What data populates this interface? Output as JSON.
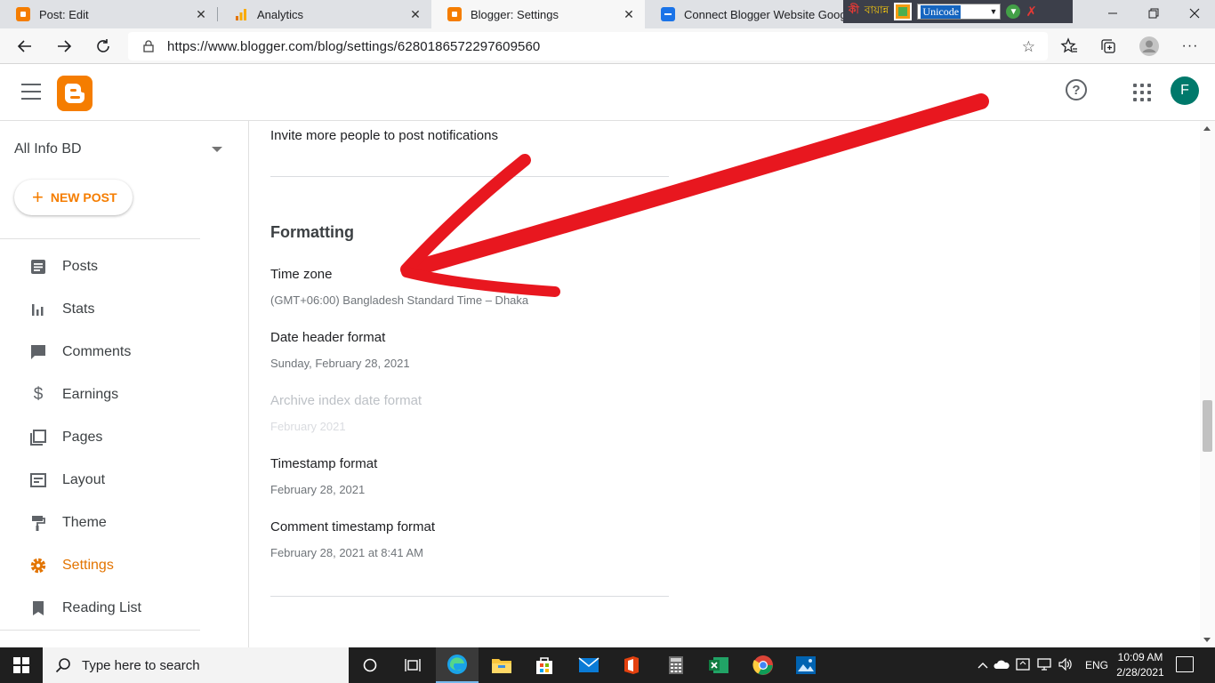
{
  "browser": {
    "tabs": [
      {
        "title": "Post: Edit",
        "icon_color": "#f57d00"
      },
      {
        "title": "Analytics",
        "icon_color": "#f9ab00"
      },
      {
        "title": "Blogger: Settings",
        "icon_color": "#f57d00"
      },
      {
        "title": "Connect Blogger Website Googl",
        "icon_color": "#1a73e8"
      }
    ],
    "language_widget": {
      "brand": "বায়ান্ন",
      "selected": "Unicode"
    },
    "url": "https://www.blogger.com/blog/settings/6280186572297609560"
  },
  "header": {
    "avatar_letter": "F",
    "help_glyph": "?"
  },
  "sidebar": {
    "blog_name": "All Info BD",
    "new_post_label": "NEW POST",
    "items": [
      {
        "label": "Posts",
        "icon": "posts-icon"
      },
      {
        "label": "Stats",
        "icon": "stats-icon"
      },
      {
        "label": "Comments",
        "icon": "comments-icon"
      },
      {
        "label": "Earnings",
        "icon": "dollar-icon"
      },
      {
        "label": "Pages",
        "icon": "pages-icon"
      },
      {
        "label": "Layout",
        "icon": "layout-icon"
      },
      {
        "label": "Theme",
        "icon": "paint-roller-icon"
      },
      {
        "label": "Settings",
        "icon": "gear-icon",
        "active": true
      },
      {
        "label": "Reading List",
        "icon": "bookmark-icon"
      }
    ]
  },
  "main": {
    "invite_text": "Invite more people to post notifications",
    "section_title": "Formatting",
    "settings": [
      {
        "label": "Time zone",
        "value": "(GMT+06:00) Bangladesh Standard Time – Dhaka",
        "disabled": false
      },
      {
        "label": "Date header format",
        "value": "Sunday, February 28, 2021",
        "disabled": false
      },
      {
        "label": "Archive index date format",
        "value": "February 2021",
        "disabled": true
      },
      {
        "label": "Timestamp format",
        "value": "February 28, 2021",
        "disabled": false
      },
      {
        "label": "Comment timestamp format",
        "value": "February 28, 2021 at 8:41 AM",
        "disabled": false
      }
    ]
  },
  "colors": {
    "accent": "#f57d00",
    "active_nav": "#e37400",
    "annotation": "#e8171f"
  },
  "taskbar": {
    "search_placeholder": "Type here to search",
    "language": "ENG",
    "time": "10:09 AM",
    "date": "2/28/2021"
  }
}
